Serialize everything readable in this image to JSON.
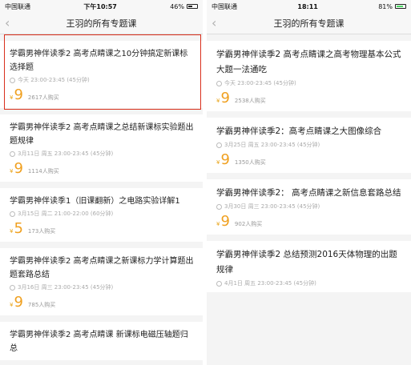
{
  "left": {
    "status": {
      "carrier": "中国联通",
      "time": "下午10:57",
      "battery": "46%",
      "battery_level": 0.46
    },
    "nav": {
      "back": "‹",
      "title": "王羽的所有专题课"
    },
    "courses": [
      {
        "title": "学霸男神伴读季2 高考点睛课之10分钟搞定新课标选择题",
        "time": "今天 23:00-23:45 (45分钟)",
        "yen": "¥",
        "price": "9",
        "buyers": "2617人购买"
      },
      {
        "title": "学霸男神伴读季2 高考点睛课之总结新课标实验题出题规律",
        "time": "3月11日 周五 23:00-23:45 (45分钟)",
        "yen": "¥",
        "price": "9",
        "buyers": "1114人购买"
      },
      {
        "title": "学霸男神伴读季1（旧课翻新）之电路实验详解1",
        "time": "3月15日 周二 21:00-22:00 (60分钟)",
        "yen": "¥",
        "price": "5",
        "buyers": "173人购买"
      },
      {
        "title": "学霸男神伴读季2 高考点睛课之新课标力学计算题出题套路总结",
        "time": "3月16日 周三 23:00-23:45 (45分钟)",
        "yen": "¥",
        "price": "9",
        "buyers": "785人购买"
      },
      {
        "title": "学霸男神伴读季2 高考点睛课 新课标电磁压轴题归总",
        "time": "",
        "yen": "",
        "price": "",
        "buyers": ""
      }
    ]
  },
  "right": {
    "status": {
      "carrier": "中国联通",
      "time": "18:11",
      "battery": "81%",
      "battery_level": 0.81
    },
    "nav": {
      "back": "‹",
      "title": "王羽的所有专题课"
    },
    "courses": [
      {
        "title": "学霸男神伴读季2 高考点睛课之高考物理基本公式大题一法通吃",
        "time": "今天 23:00-23:45 (45分钟)",
        "yen": "¥",
        "price": "9",
        "buyers": "2538人购买"
      },
      {
        "title": "学霸男神伴读季2：高考点睛课之大图像综合",
        "time": "3月25日 周五 23:00-23:45 (45分钟)",
        "yen": "¥",
        "price": "9",
        "buyers": "1350人购买"
      },
      {
        "title": "学霸男神伴读季2： 高考点睛课之新信息套路总结",
        "time": "3月30日 周三 23:00-23:45 (45分钟)",
        "yen": "¥",
        "price": "9",
        "buyers": "902人购买"
      },
      {
        "title": "学霸男神伴读季2 总结预测2016天体物理的出题规律",
        "time": "4月1日 周五 23:00-23:45 (45分钟)",
        "yen": "",
        "price": "",
        "buyers": ""
      }
    ]
  }
}
